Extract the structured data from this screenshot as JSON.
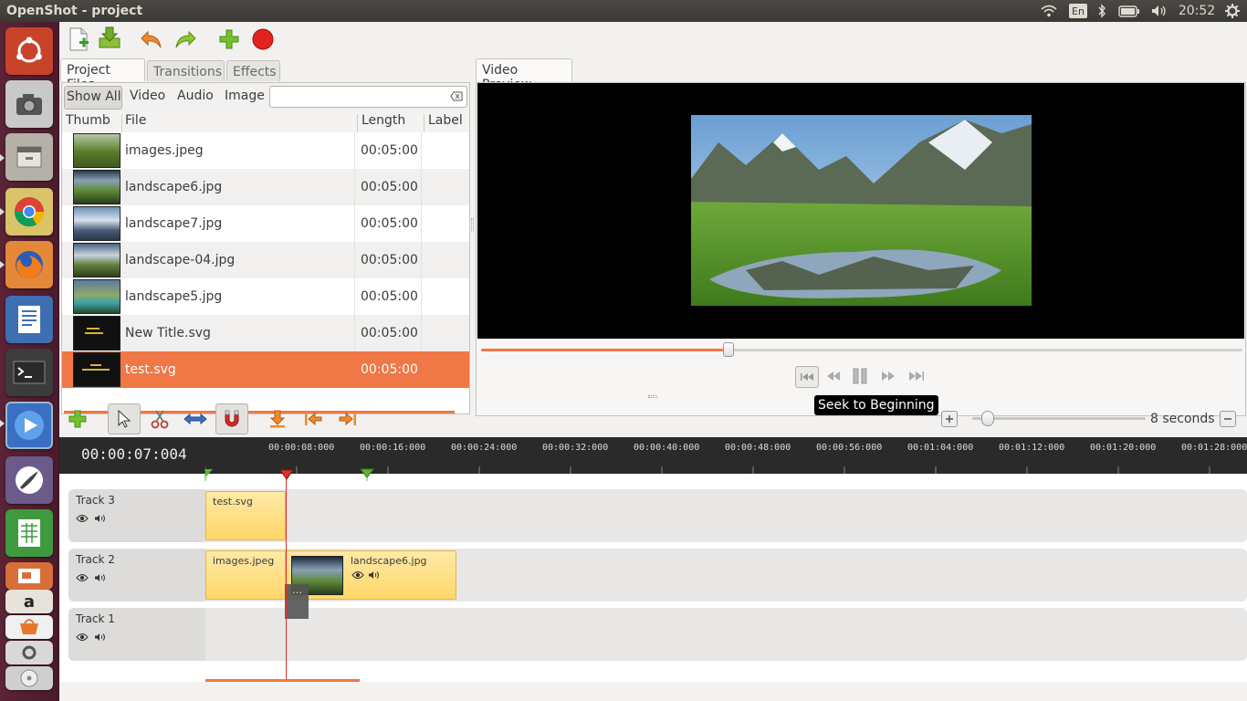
{
  "window_title": "OpenShot - project",
  "topbar": {
    "keyboard": "En",
    "time": "20:52"
  },
  "tabs_left": [
    "Project Files",
    "Transitions",
    "Effects"
  ],
  "filters": [
    "Show All",
    "Video",
    "Audio",
    "Image"
  ],
  "search": {
    "value": "",
    "placeholder": ""
  },
  "columns": [
    "Thumb",
    "File",
    "Length",
    "Label"
  ],
  "files": [
    {
      "name": "images.jpeg",
      "length": "00:05:00",
      "label": ""
    },
    {
      "name": "landscape6.jpg",
      "length": "00:05:00",
      "label": ""
    },
    {
      "name": "landscape7.jpg",
      "length": "00:05:00",
      "label": ""
    },
    {
      "name": "landscape-04.jpg",
      "length": "00:05:00",
      "label": ""
    },
    {
      "name": "landscape5.jpg",
      "length": "00:05:00",
      "label": ""
    },
    {
      "name": "New Title.svg",
      "length": "00:05:00",
      "label": ""
    },
    {
      "name": "test.svg",
      "length": "00:05:00",
      "label": ""
    }
  ],
  "preview_tab": "Video Preview",
  "playback_progress": 0.325,
  "tooltip": "Seek to Beginning",
  "zoom_label": "8 seconds",
  "zoom_level": 0.05,
  "timecode": "00:00:07:004",
  "ruler_ticks": [
    "00:00:08:000",
    "00:00:16:000",
    "00:00:24:000",
    "00:00:32:000",
    "00:00:40:000",
    "00:00:48:000",
    "00:00:56:000",
    "00:01:04:000",
    "00:01:12:000",
    "00:01:20:000",
    "00:01:28:000"
  ],
  "tracks": [
    {
      "name": "Track 3"
    },
    {
      "name": "Track 2"
    },
    {
      "name": "Track 1"
    }
  ],
  "clips": {
    "t3_a": "test.svg",
    "t2_a": "images.jpeg",
    "t2_b": "landscape6.jpg"
  },
  "colors": {
    "accent": "#f07746",
    "selection": "#f07746",
    "playhead": "#e0302c",
    "clip": "#fdd76a"
  }
}
